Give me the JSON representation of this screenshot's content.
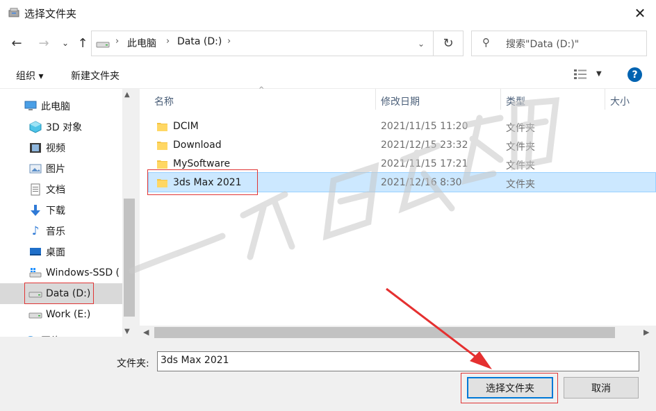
{
  "window": {
    "title": "选择文件夹"
  },
  "address": {
    "crumbs": [
      "此电脑",
      "Data (D:)"
    ]
  },
  "search": {
    "placeholder": "搜索\"Data (D:)\""
  },
  "toolbar": {
    "organize_label": "组织 ▾",
    "new_folder_label": "新建文件夹",
    "help_label": "?"
  },
  "sidebar": {
    "items": [
      {
        "label": "此电脑",
        "icon": "computer-icon"
      },
      {
        "label": "3D 对象",
        "icon": "cube-icon"
      },
      {
        "label": "视频",
        "icon": "video-icon"
      },
      {
        "label": "图片",
        "icon": "picture-icon"
      },
      {
        "label": "文档",
        "icon": "document-icon"
      },
      {
        "label": "下载",
        "icon": "download-icon"
      },
      {
        "label": "音乐",
        "icon": "music-icon"
      },
      {
        "label": "桌面",
        "icon": "desktop-icon"
      },
      {
        "label": "Windows-SSD (",
        "icon": "windows-drive-icon"
      },
      {
        "label": "Data (D:)",
        "icon": "drive-icon"
      },
      {
        "label": "Work (E:)",
        "icon": "drive-icon"
      },
      {
        "label": "网络",
        "icon": "network-icon"
      }
    ]
  },
  "columns": {
    "name": "名称",
    "modified": "修改日期",
    "type": "类型",
    "size": "大小"
  },
  "files": [
    {
      "name": "DCIM",
      "modified": "2021/11/15 11:20",
      "type": "文件夹"
    },
    {
      "name": "Download",
      "modified": "2021/12/15 23:32",
      "type": "文件夹"
    },
    {
      "name": "MySoftware",
      "modified": "2021/11/15 17:21",
      "type": "文件夹"
    },
    {
      "name": "3ds Max 2021",
      "modified": "2021/12/16 8:30",
      "type": "文件夹"
    }
  ],
  "footer": {
    "folder_label": "文件夹:",
    "folder_value": "3ds Max 2021",
    "select_label": "选择文件夹",
    "cancel_label": "取消"
  },
  "colors": {
    "accent": "#0078d7",
    "selection": "#cce8ff",
    "highlight_box": "#e03434"
  }
}
